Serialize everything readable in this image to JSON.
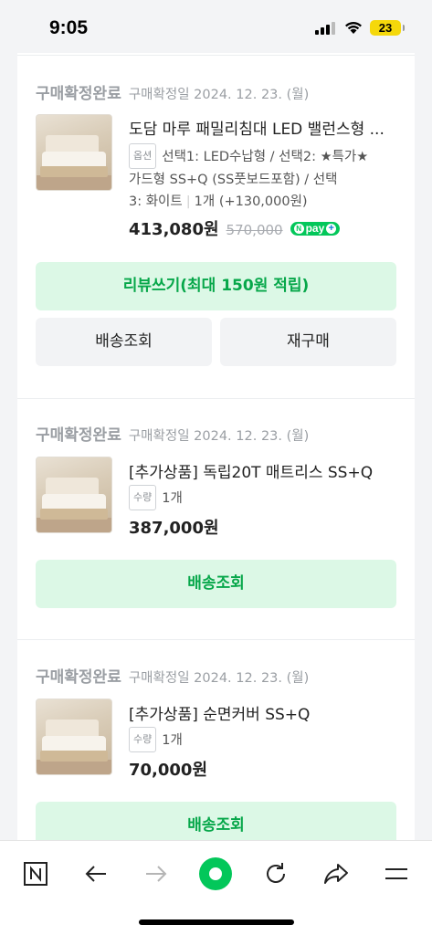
{
  "status_bar": {
    "time": "9:05",
    "battery": "23"
  },
  "orders": [
    {
      "status": "구매확정완료",
      "date": "구매확정일 2024. 12. 23. (월)",
      "product_name": "도담 마루 패밀리침대 LED 밸런스형 ...",
      "option_tag": "옵션",
      "option_lines": [
        "선택1: LED수납형 / 선택2: ★특가★",
        "가드형 SS+Q (SS풋보드포함) / 선택",
        "3: 화이트"
      ],
      "quantity": "1개 (+130,000원)",
      "price": "413,080원",
      "original_price": "570,000",
      "npay_label": "pay",
      "buttons": {
        "review": "리뷰쓰기(최대 150원 적립)",
        "track": "배송조회",
        "reorder": "재구매"
      }
    },
    {
      "status": "구매확정완료",
      "date": "구매확정일 2024. 12. 23. (월)",
      "product_name": "[추가상품] 독립20T 매트리스 SS+Q",
      "qty_tag": "수량",
      "quantity": "1개",
      "price": "387,000원",
      "buttons": {
        "track": "배송조회"
      }
    },
    {
      "status": "구매확정완료",
      "date": "구매확정일 2024. 12. 23. (월)",
      "product_name": "[추가상품] 순면커버 SS+Q",
      "qty_tag": "수량",
      "quantity": "1개",
      "price": "70,000원",
      "buttons": {
        "track": "배송조회"
      }
    }
  ],
  "bottom_nav": [
    "naver-n-icon",
    "back-arrow-icon",
    "forward-arrow-icon",
    "green-dot-icon",
    "refresh-icon",
    "share-icon",
    "menu-icon"
  ],
  "colors": {
    "accent_green": "#03c75a",
    "button_green_bg": "#dcf8e6",
    "button_green_text": "#07a74a"
  }
}
